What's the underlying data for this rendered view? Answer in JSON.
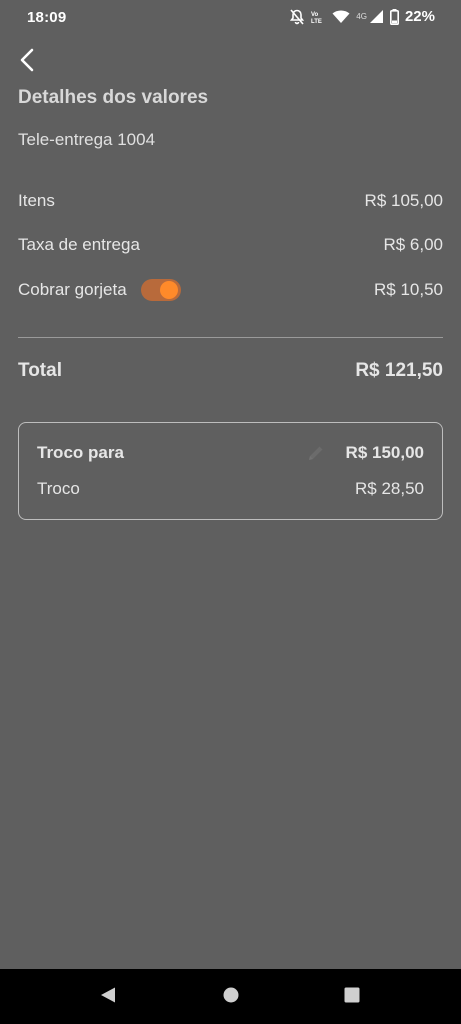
{
  "status_bar": {
    "time": "18:09",
    "network_small": "4G",
    "battery": "22%",
    "icons": [
      "bell-off-icon",
      "volte-icon",
      "wifi-icon",
      "signal-icon",
      "battery-icon"
    ]
  },
  "header": {
    "back_icon": "chevron-left-icon",
    "title": "Detalhes dos valores",
    "subtitle": "Tele-entrega 1004"
  },
  "summary": {
    "items_label": "Itens",
    "items_value": "R$ 105,00",
    "delivery_label": "Taxa de entrega",
    "delivery_value": "R$ 6,00",
    "tip_label": "Cobrar gorjeta",
    "tip_enabled": true,
    "tip_value": "R$ 10,50"
  },
  "total": {
    "label": "Total",
    "value": "R$ 121,50"
  },
  "change": {
    "change_for_label": "Troco para",
    "change_for_value": "R$ 150,00",
    "change_label": "Troco",
    "change_value": "R$ 28,50",
    "edit_icon": "pencil-icon"
  },
  "colors": {
    "background": "#5f5f5f",
    "accent": "#ff8a2a",
    "toggle_track": "#b86a3b",
    "navbar": "#000000"
  },
  "navigation": {
    "back": "back-triangle-icon",
    "home": "home-circle-icon",
    "recents": "recents-square-icon"
  }
}
